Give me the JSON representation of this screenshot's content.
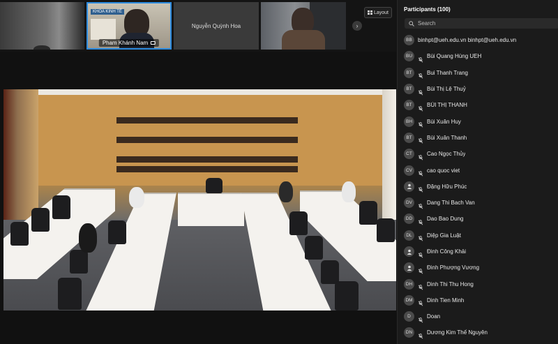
{
  "strip": {
    "tiles": [
      {
        "name": ""
      },
      {
        "name": "Pham Khánh Nam",
        "sign": "KHOA KINH TẾ"
      },
      {
        "name": "Nguyễn Quỳnh Hoa"
      },
      {
        "name": ""
      }
    ],
    "next_icon": "chevron-right-icon",
    "layout_label": "Layout"
  },
  "participants": {
    "header": "Participants (100)",
    "search_placeholder": "Search",
    "items": [
      {
        "initials": "BB",
        "name": "binhpt@ueh.edu.vn binhpt@ueh.edu.vn",
        "muted": false
      },
      {
        "initials": "BU",
        "name": "Bùi Quang Hùng UEH",
        "muted": true
      },
      {
        "initials": "BT",
        "name": "Bui Thanh Trang",
        "muted": true
      },
      {
        "initials": "BT",
        "name": "Bùi Thị Lệ Thuỷ",
        "muted": true
      },
      {
        "initials": "BT",
        "name": "BÙI THỊ THANH",
        "muted": true
      },
      {
        "initials": "BH",
        "name": "Bùi Xuân Huy",
        "muted": true
      },
      {
        "initials": "BT",
        "name": "Bùi Xuân Thanh",
        "muted": true
      },
      {
        "initials": "CT",
        "name": "Cao Ngọc Thủy",
        "muted": true
      },
      {
        "initials": "CV",
        "name": "cao quoc viet",
        "muted": true
      },
      {
        "initials": "",
        "name": "Đặng Hữu Phúc",
        "muted": true
      },
      {
        "initials": "DV",
        "name": "Dang Thi Bach Van",
        "muted": true
      },
      {
        "initials": "DD",
        "name": "Dao Bao Dung",
        "muted": true
      },
      {
        "initials": "DL",
        "name": "Diệp Gia Luật",
        "muted": true
      },
      {
        "initials": "",
        "name": "Đinh Công Khải",
        "muted": true
      },
      {
        "initials": "",
        "name": "Đinh Phượng Vương",
        "muted": true
      },
      {
        "initials": "DH",
        "name": "Dinh Thi Thu Hong",
        "muted": true
      },
      {
        "initials": "DM",
        "name": "Dinh Tien Minh",
        "muted": true
      },
      {
        "initials": "D",
        "name": "Doan",
        "muted": true
      },
      {
        "initials": "DN",
        "name": "Dương Kim Thế Nguyên",
        "muted": true
      }
    ]
  }
}
